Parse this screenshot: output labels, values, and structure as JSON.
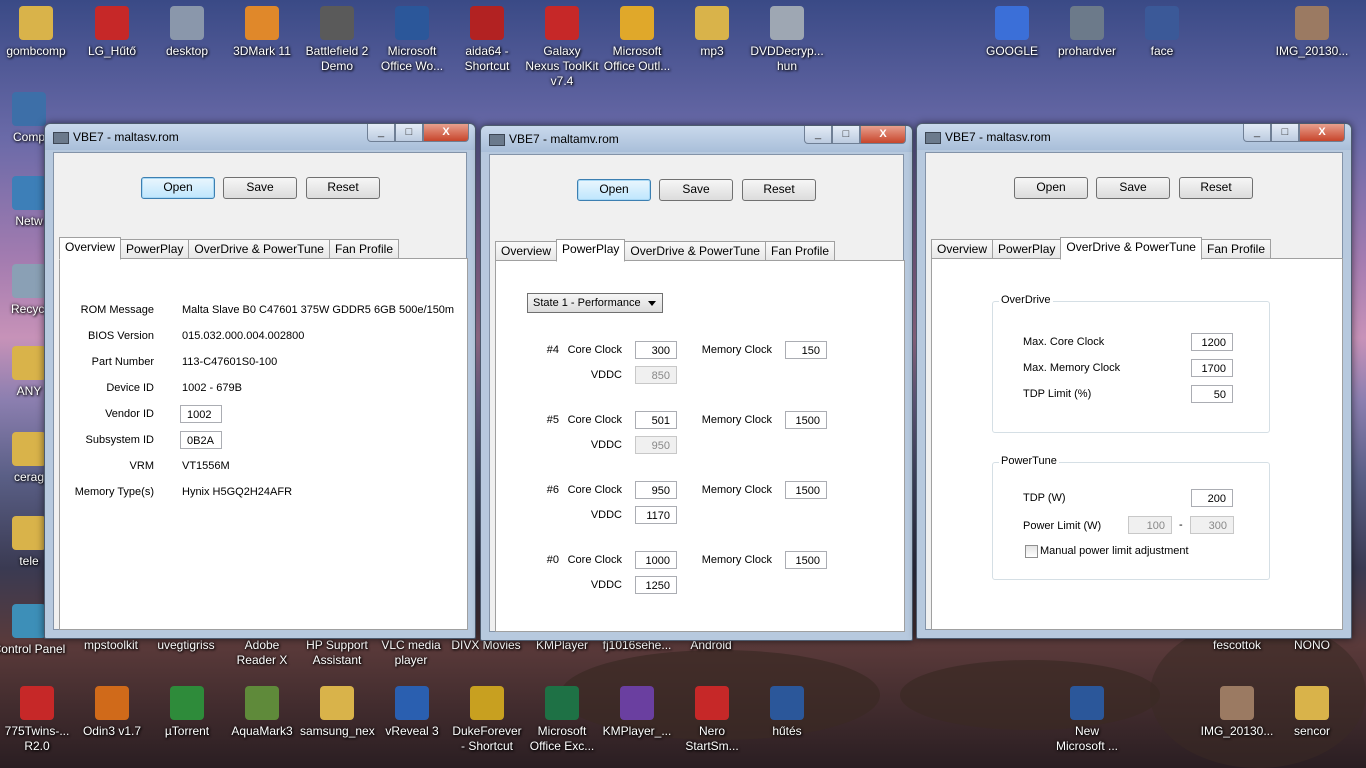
{
  "desktop": {
    "top_row": [
      {
        "label": "gombcomp",
        "icon": "folder-icon",
        "color": "#d9b34a"
      },
      {
        "label": "LG_Hűtő",
        "icon": "pdf-icon",
        "color": "#c62828"
      },
      {
        "label": "desktop",
        "icon": "settings-doc-icon",
        "color": "#8a97ab"
      },
      {
        "label": "3DMark 11",
        "icon": "3dmark-icon",
        "color": "#e0882a"
      },
      {
        "label": "Battlefield 2 Demo",
        "icon": "battlefield-icon",
        "color": "#5a5a5a"
      },
      {
        "label": "Microsoft Office Wo...",
        "icon": "word-icon",
        "color": "#2b579a"
      },
      {
        "label": "aida64 - Shortcut",
        "icon": "aida64-icon",
        "color": "#b22222"
      },
      {
        "label": "Galaxy Nexus ToolKit v7.4",
        "icon": "toolkit-icon",
        "color": "#c62828"
      },
      {
        "label": "Microsoft Office Outl...",
        "icon": "outlook-icon",
        "color": "#e0a82a"
      },
      {
        "label": "mp3",
        "icon": "folder-icon",
        "color": "#d9b34a"
      },
      {
        "label": "DVDDecryp... hun",
        "icon": "dvd-icon",
        "color": "#9ea7b3"
      },
      {
        "label": "GOOGLE",
        "icon": "google-icon",
        "color": "#3b6fd8"
      },
      {
        "label": "prohardver",
        "icon": "web-shortcut-icon",
        "color": "#6c7a8a"
      },
      {
        "label": "face",
        "icon": "facebook-icon",
        "color": "#3b5998"
      },
      {
        "label": "IMG_20130...",
        "icon": "photo-icon",
        "color": "#9b7a62"
      }
    ],
    "left_col": [
      {
        "label": "Comp",
        "icon": "computer-icon",
        "color": "#3d6fa8"
      },
      {
        "label": "Netw",
        "icon": "network-icon",
        "color": "#3d7fb8"
      },
      {
        "label": "Recycl",
        "icon": "recycle-bin-icon",
        "color": "#8aa0b5"
      },
      {
        "label": "ANY",
        "icon": "folder-icon",
        "color": "#d9b34a"
      },
      {
        "label": "cerag",
        "icon": "folder-icon",
        "color": "#d9b34a"
      },
      {
        "label": "tele",
        "icon": "folder-icon",
        "color": "#d9b34a"
      },
      {
        "label": "Control Panel",
        "icon": "control-panel-icon",
        "color": "#3d8fb8"
      }
    ],
    "hidden_row_labels": [
      "mpstoolkit",
      "uvegtigriss",
      "Adobe Reader X",
      "HP Support Assistant",
      "VLC media player",
      "DIVX Movies",
      "KMPlayer",
      "fj1016sehe...",
      "Android",
      "fescottok",
      "NONO"
    ],
    "bottom_row": [
      {
        "label": "775Twins-... R2.0",
        "icon": "pdf-icon",
        "color": "#c62828"
      },
      {
        "label": "Odin3 v1.7",
        "icon": "odin-icon",
        "color": "#d06a1a"
      },
      {
        "label": "µTorrent",
        "icon": "utorrent-icon",
        "color": "#2e8b3a"
      },
      {
        "label": "AquaMark3",
        "icon": "aquamark-icon",
        "color": "#5f8a3a"
      },
      {
        "label": "samsung_nex",
        "icon": "folder-icon",
        "color": "#d9b34a"
      },
      {
        "label": "vReveal 3",
        "icon": "vreveal-icon",
        "color": "#2a5fb0"
      },
      {
        "label": "DukeForever - Shortcut",
        "icon": "duke-icon",
        "color": "#c8a020"
      },
      {
        "label": "Microsoft Office Exc...",
        "icon": "excel-icon",
        "color": "#1e7145"
      },
      {
        "label": "KMPlayer_...",
        "icon": "kmplayer-icon",
        "color": "#6a3fa0"
      },
      {
        "label": "Nero StartSm...",
        "icon": "nero-icon",
        "color": "#c62828"
      },
      {
        "label": "hűtés",
        "icon": "word-doc-icon",
        "color": "#2b579a"
      },
      {
        "label": "New Microsoft ...",
        "icon": "word-doc-icon",
        "color": "#2b579a"
      },
      {
        "label": "IMG_20130...",
        "icon": "photo-icon",
        "color": "#9b7a62"
      },
      {
        "label": "sencor",
        "icon": "folder-icon",
        "color": "#d9b34a"
      }
    ]
  },
  "common": {
    "open": "Open",
    "save": "Save",
    "reset": "Reset",
    "tabs": [
      "Overview",
      "PowerPlay",
      "OverDrive & PowerTune",
      "Fan Profile"
    ],
    "minimize": "_",
    "maximize": "□",
    "close": "X"
  },
  "win1": {
    "title": "VBE7 - maltasv.rom",
    "overview": {
      "rom_message_label": "ROM Message",
      "rom_message": "Malta Slave B0 C47601 375W GDDR5 6GB 500e/150m",
      "bios_label": "BIOS Version",
      "bios": "015.032.000.004.002800",
      "part_label": "Part Number",
      "part": "113-C47601S0-100",
      "device_label": "Device ID",
      "device": "1002 - 679B",
      "vendor_label": "Vendor ID",
      "vendor": "1002",
      "subsystem_label": "Subsystem ID",
      "subsystem": "0B2A",
      "vrm_label": "VRM",
      "vrm": "VT1556M",
      "memtype_label": "Memory Type(s)",
      "memtype": "Hynix H5GQ2H24AFR"
    }
  },
  "win2": {
    "title": "VBE7 - maltamv.rom",
    "state_select": "State 1 - Performance",
    "core_clock_label": "Core Clock",
    "memory_clock_label": "Memory Clock",
    "vddc_label": "VDDC",
    "states": [
      {
        "id": "#4",
        "core": "300",
        "memory": "150",
        "vddc": "850",
        "vddc_disabled": true
      },
      {
        "id": "#5",
        "core": "501",
        "memory": "1500",
        "vddc": "950",
        "vddc_disabled": true
      },
      {
        "id": "#6",
        "core": "950",
        "memory": "1500",
        "vddc": "1170",
        "vddc_disabled": false
      },
      {
        "id": "#0",
        "core": "1000",
        "memory": "1500",
        "vddc": "1250",
        "vddc_disabled": false
      }
    ]
  },
  "win3": {
    "title": "VBE7 - maltasv.rom",
    "overdrive": {
      "group_title": "OverDrive",
      "max_core_label": "Max. Core Clock",
      "max_core": "1200",
      "max_mem_label": "Max. Memory Clock",
      "max_mem": "1700",
      "tdp_limit_label": "TDP Limit (%)",
      "tdp_limit": "50"
    },
    "powertune": {
      "group_title": "PowerTune",
      "tdp_label": "TDP (W)",
      "tdp": "200",
      "power_limit_label": "Power Limit (W)",
      "power_min": "100",
      "power_dash": "-",
      "power_max": "300",
      "manual_label": "Manual power limit adjustment"
    }
  }
}
